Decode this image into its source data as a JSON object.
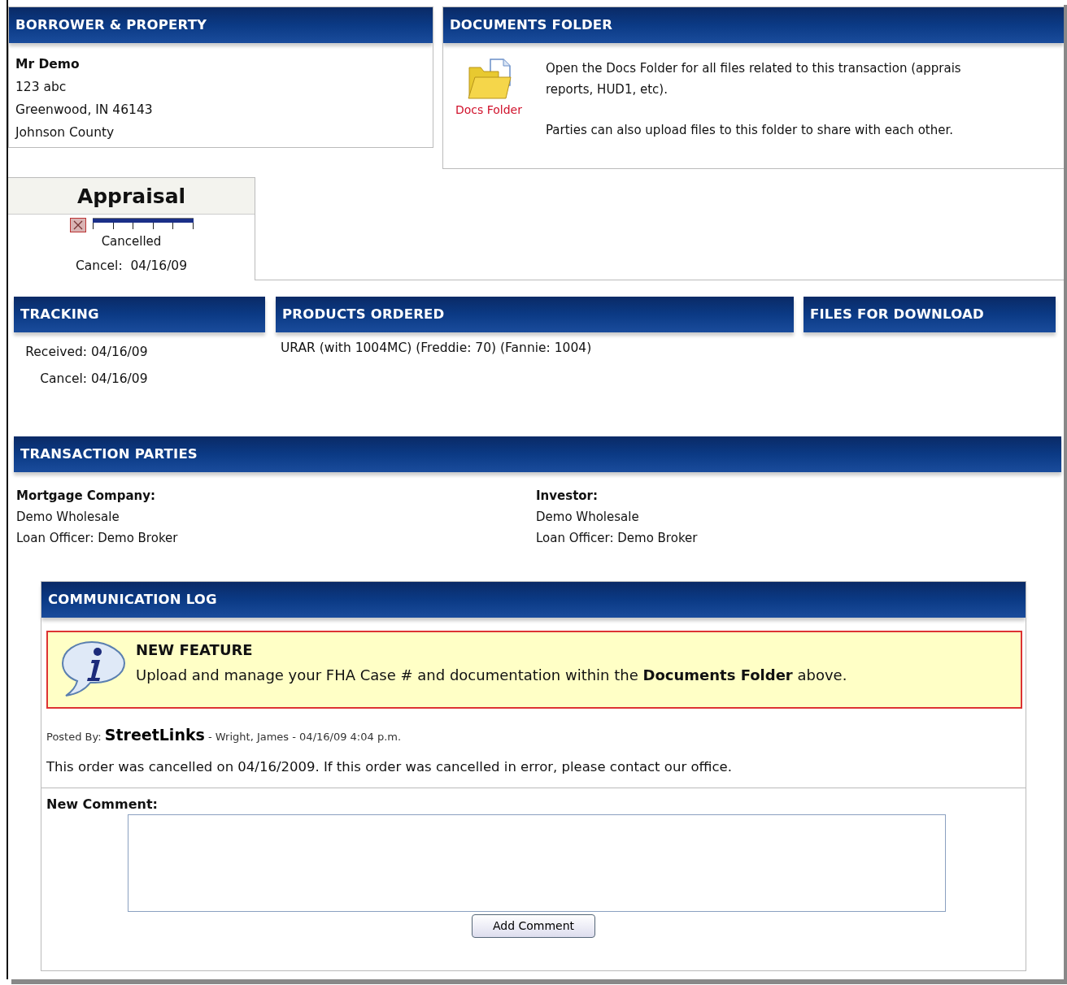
{
  "borrower_panel": {
    "title": "BORROWER & PROPERTY",
    "name": "Mr Demo",
    "address_lines": [
      "123 abc",
      "Greenwood, IN 46143",
      "Johnson County"
    ]
  },
  "documents_panel": {
    "title": "DOCUMENTS FOLDER",
    "folder_label": "Docs Folder",
    "description_lines": [
      "Open the Docs Folder for all files related to this transaction (apprais",
      "reports, HUD1, etc)."
    ],
    "note": "Parties can also upload files to this folder to share with each other."
  },
  "order_status": {
    "title": "Appraisal",
    "cancelled": true,
    "level": 1,
    "status": "Cancelled",
    "date_label": "Cancel:",
    "date": "04/16/09"
  },
  "tracking": {
    "title": "TRACKING",
    "rows": [
      {
        "label": "Received:",
        "value": "04/16/09"
      },
      {
        "label": "Cancel:",
        "value": "04/16/09"
      }
    ]
  },
  "products": {
    "title": "PRODUCTS ORDERED",
    "items": [
      "URAR (with 1004MC) (Freddie: 70) (Fannie: 1004)"
    ]
  },
  "files": {
    "title": "FILES FOR DOWNLOAD"
  },
  "parties": {
    "title": "TRANSACTION PARTIES",
    "columns": [
      {
        "role": "Mortgage Company:",
        "company": "Demo Wholesale",
        "officer": "Loan Officer: Demo Broker"
      },
      {
        "role": "Investor:",
        "company": "Demo Wholesale",
        "officer": "Loan Officer: Demo Broker"
      }
    ]
  },
  "communication_log": {
    "title": "COMMUNICATION LOG",
    "notice": {
      "heading": "NEW FEATURE",
      "text": "Upload and manage your FHA Case # and documentation within the **Documents Folder** above."
    },
    "posts": [
      {
        "posted_by_label": "Posted By:",
        "author": "StreetLinks",
        "details": "- Wright, James - 04/16/09 4:04 p.m.",
        "message": "This order was cancelled on 04/16/2009. If this order was cancelled in error, please contact our office."
      }
    ],
    "new_comment": {
      "label": "New Comment:",
      "button": "Add Comment"
    }
  }
}
